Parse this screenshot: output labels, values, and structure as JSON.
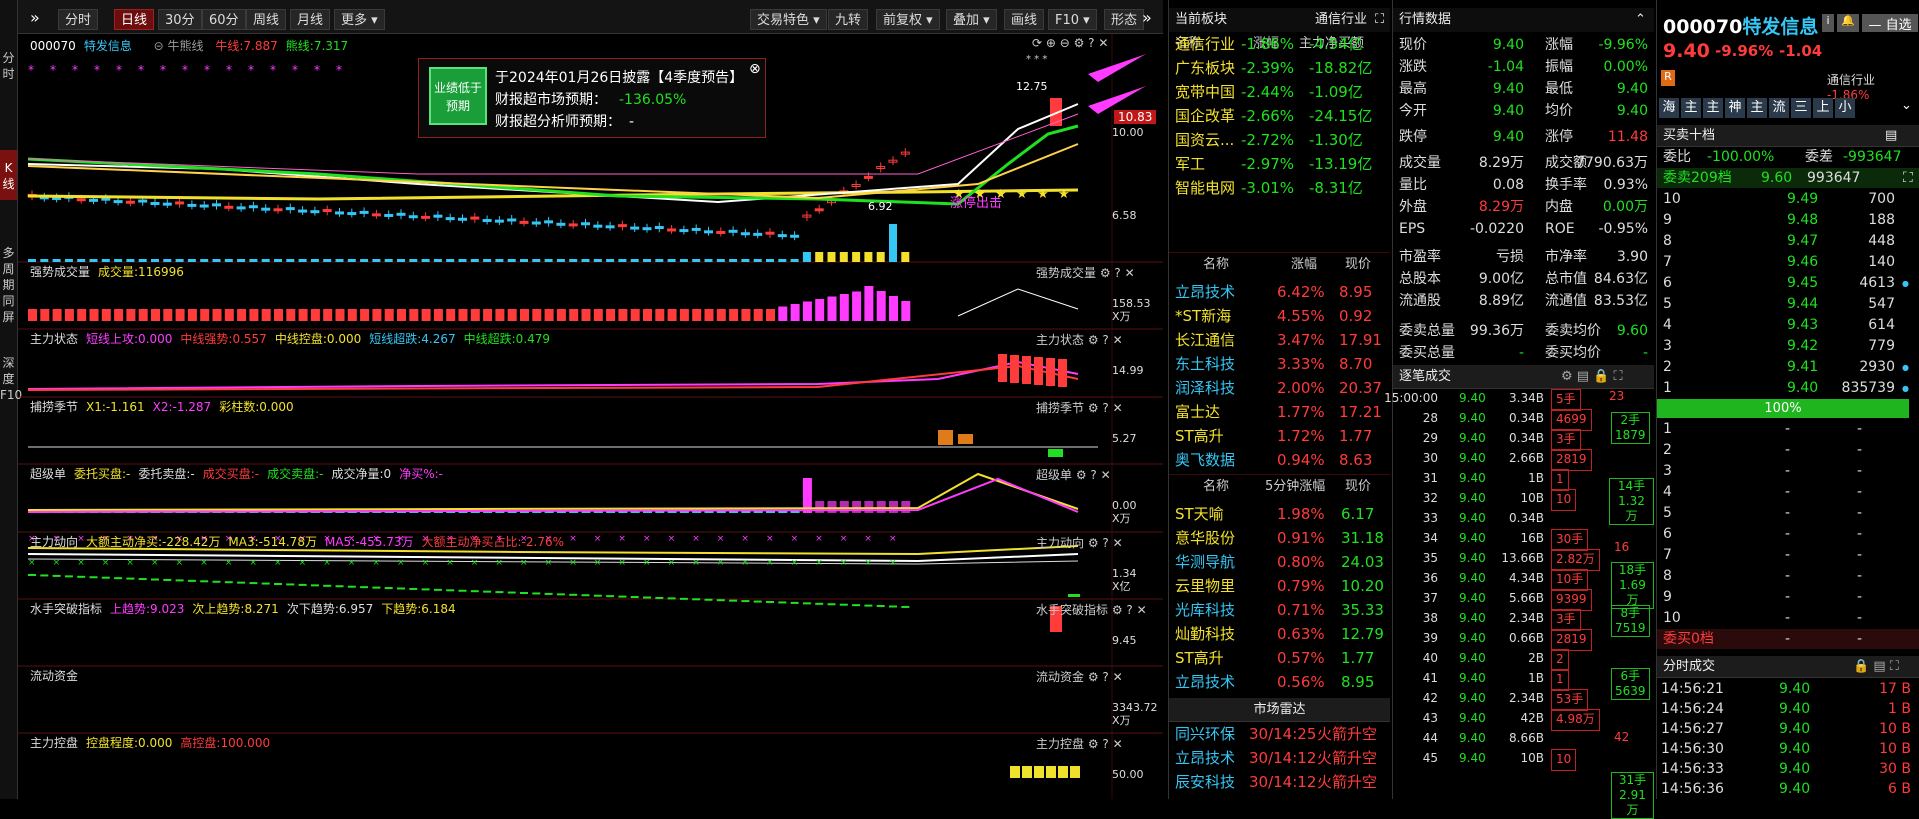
{
  "left_tabs": [
    "分时",
    "K线",
    "多周期同屏",
    "深度F10"
  ],
  "toolbar": {
    "left": [
      "分时",
      "日线",
      "30分",
      "60分",
      "周线",
      "月线",
      "更多"
    ],
    "right": [
      "交易特色",
      "九转",
      "前复权",
      "叠加",
      "画线",
      "F10",
      "形态"
    ]
  },
  "chart": {
    "code": "000070",
    "name": "特发信息",
    "line": "牛熊线",
    "bull": "牛线:7.887",
    "bear": "熊线:7.317",
    "price_high": "12.75",
    "price_low": "6.92",
    "price_tag": "10.83",
    "axis": [
      "10.00",
      "6.58"
    ],
    "annotation": "涨停出击",
    "popup": {
      "icon": "业绩低于预期",
      "line1": "于2024年01月26日披露【4季度预告】",
      "line2_label": "财报超市场预期：",
      "line2_value": "-136.05%",
      "line3_label": "财报超分析师预期：",
      "line3_value": "-"
    }
  },
  "indicators": [
    {
      "title": "强势成交量",
      "items": [
        "成交量:116996"
      ],
      "axis": [
        "158.53",
        "X万"
      ]
    },
    {
      "title": "主力状态",
      "items": [
        "短线上攻:0.000",
        "中线强势:0.557",
        "中线控盘:0.000",
        "短线超跌:4.267",
        "中线超跌:0.479"
      ],
      "axis": [
        "14.99"
      ]
    },
    {
      "title": "捕捞季节",
      "items": [
        "X1:-1.161",
        "X2:-1.287",
        "彩柱数:0.000"
      ],
      "axis": [
        "5.27"
      ]
    },
    {
      "title": "超级单",
      "items": [
        "委托买盘:-",
        "委托卖盘:-",
        "成交买盘:-",
        "成交卖盘:-",
        "成交净量:0",
        "净买%:-"
      ],
      "axis": [
        "0.00",
        "X万"
      ]
    },
    {
      "title": "主力动向",
      "items": [
        "大额主动净买:-228.42万",
        "MA3:-514.78万",
        "MA5:-455.73万",
        "大额主动净买占比:-2.76%"
      ],
      "axis": [
        "1.34",
        "X亿"
      ]
    },
    {
      "title": "水手突破指标",
      "items": [
        "上趋势:9.023",
        "次上趋势:8.271",
        "次下趋势:6.957",
        "下趋势:6.184"
      ],
      "axis": [
        "9.45"
      ]
    },
    {
      "title": "流动资金",
      "items": [],
      "axis": [
        "3343.72",
        "X万"
      ]
    },
    {
      "title": "主力控盘",
      "items": [
        "控盘程度:0.000",
        "高控盘:100.000"
      ],
      "axis": [
        "50.00"
      ]
    }
  ],
  "sector": {
    "title": "当前板块",
    "industry": "通信行业",
    "cols": [
      "名称",
      "涨幅",
      "主力净买额"
    ],
    "rows": [
      [
        "通信行业",
        "-1.86%",
        "-4.54亿"
      ],
      [
        "广东板块",
        "-2.39%",
        "-18.82亿"
      ],
      [
        "宽带中国",
        "-2.44%",
        "-1.09亿"
      ],
      [
        "国企改革",
        "-2.66%",
        "-24.15亿"
      ],
      [
        "国资云...",
        "-2.72%",
        "-1.30亿"
      ],
      [
        "军工",
        "-2.97%",
        "-13.19亿"
      ],
      [
        "智能电网",
        "-3.01%",
        "-8.31亿"
      ]
    ],
    "stock_cols": [
      "名称",
      "涨幅",
      "现价"
    ],
    "stocks": [
      [
        "立昂技术",
        "6.42%",
        "8.95"
      ],
      [
        "*ST新海",
        "4.55%",
        "0.92"
      ],
      [
        "长江通信",
        "3.47%",
        "17.91"
      ],
      [
        "东土科技",
        "3.33%",
        "8.70"
      ],
      [
        "润泽科技",
        "2.00%",
        "20.37"
      ],
      [
        "富士达",
        "1.77%",
        "17.21"
      ],
      [
        "ST高升",
        "1.72%",
        "1.77"
      ],
      [
        "奥飞数据",
        "0.94%",
        "8.63"
      ]
    ],
    "speed_cols": [
      "名称",
      "5分钟涨幅",
      "现价"
    ],
    "speed": [
      [
        "ST天喻",
        "1.98%",
        "6.17"
      ],
      [
        "意华股份",
        "0.91%",
        "31.18"
      ],
      [
        "华测导航",
        "0.80%",
        "24.03"
      ],
      [
        "云里物里",
        "0.79%",
        "10.20"
      ],
      [
        "光库科技",
        "0.71%",
        "35.33"
      ],
      [
        "灿勤科技",
        "0.63%",
        "12.79"
      ],
      [
        "ST高升",
        "0.57%",
        "1.77"
      ],
      [
        "立昂技术",
        "0.56%",
        "8.95"
      ]
    ],
    "radar_title": "市场雷达",
    "radar": [
      [
        "同兴环保",
        "30/14:25",
        "火箭升空"
      ],
      [
        "立昂技术",
        "30/14:12",
        "火箭升空"
      ],
      [
        "辰安科技",
        "30/14:12",
        "火箭升空"
      ]
    ]
  },
  "quote": {
    "title": "行情数据",
    "rows": [
      [
        "现价",
        "9.40",
        "涨幅",
        "-9.96%"
      ],
      [
        "涨跌",
        "-1.04",
        "振幅",
        "0.00%"
      ],
      [
        "最高",
        "9.40",
        "最低",
        "9.40"
      ],
      [
        "今开",
        "9.40",
        "均价",
        "9.40"
      ],
      [
        "跌停",
        "9.40",
        "涨停",
        "11.48"
      ],
      [
        "成交量",
        "8.29万",
        "成交额",
        "7790.63万"
      ],
      [
        "量比",
        "0.08",
        "换手率",
        "0.93%"
      ],
      [
        "外盘",
        "8.29万",
        "内盘",
        "0.00万"
      ],
      [
        "EPS",
        "-0.0220",
        "ROE",
        "-0.95%"
      ],
      [
        "市盈率",
        "亏损",
        "市净率",
        "3.90"
      ],
      [
        "总股本",
        "9.00亿",
        "总市值",
        "84.63亿"
      ],
      [
        "流通股",
        "8.89亿",
        "流通值",
        "83.53亿"
      ],
      [
        "委卖总量",
        "99.36万",
        "委卖均价",
        "9.60"
      ],
      [
        "委买总量",
        "-",
        "委买均价",
        "-"
      ]
    ],
    "ticks_title": "逐笔成交",
    "ticks": [
      [
        "15:00:00",
        "9.40",
        "3.34B",
        "5手",
        "23"
      ],
      [
        "28",
        "9.40",
        "0.34B",
        "4699",
        ""
      ],
      [
        "29",
        "9.40",
        "0.34B",
        "3手",
        ""
      ],
      [
        "30",
        "9.40",
        "2.66B",
        "2819",
        ""
      ],
      [
        "31",
        "9.40",
        "1B",
        "1",
        ""
      ],
      [
        "32",
        "9.40",
        "10B",
        "10",
        ""
      ],
      [
        "33",
        "9.40",
        "0.34B",
        "",
        ""
      ],
      [
        "34",
        "9.40",
        "16B",
        "30手",
        ""
      ],
      [
        "35",
        "9.40",
        "13.66B",
        "2.82万",
        ""
      ],
      [
        "36",
        "9.40",
        "4.34B",
        "10手",
        ""
      ],
      [
        "37",
        "9.40",
        "5.66B",
        "9399",
        ""
      ],
      [
        "38",
        "9.40",
        "2.34B",
        "3手",
        ""
      ],
      [
        "39",
        "9.40",
        "0.66B",
        "2819",
        ""
      ],
      [
        "40",
        "9.40",
        "2B",
        "2",
        ""
      ],
      [
        "41",
        "9.40",
        "1B",
        "1",
        ""
      ],
      [
        "42",
        "9.40",
        "2.34B",
        "53手",
        ""
      ],
      [
        "43",
        "9.40",
        "42B",
        "4.98万",
        ""
      ],
      [
        "44",
        "9.40",
        "8.66B",
        "",
        ""
      ],
      [
        "45",
        "9.40",
        "10B",
        "10",
        ""
      ]
    ],
    "tick_right": [
      [
        "2手",
        "1879"
      ],
      [
        "16"
      ],
      [
        "18手",
        "1.69万"
      ],
      [
        "8手",
        "7519"
      ],
      [
        "6手",
        "5639"
      ],
      [
        "42"
      ],
      [
        "31手",
        "2.91万"
      ]
    ],
    "tick_right_top": [
      "14手",
      "1.32万"
    ]
  },
  "order": {
    "code": "000070",
    "name": "特发信息",
    "self": "自选",
    "price": "9.40",
    "pct": "-9.96%",
    "chg": "-1.04",
    "industry": "通信行业",
    "ind_pct": "-1.86%",
    "tags": [
      "海",
      "主",
      "主",
      "神",
      "主",
      "流",
      "三",
      "上",
      "小"
    ],
    "book_title": "买卖十档",
    "weibi_label": "委比",
    "weibi": "-100.00%",
    "weicha_label": "委差",
    "weicha": "-993647",
    "sell_label": "委卖209档",
    "sell_price": "9.60",
    "sell_vol": "993647",
    "asks": [
      [
        "10",
        "9.49",
        "700"
      ],
      [
        "9",
        "9.48",
        "188"
      ],
      [
        "8",
        "9.47",
        "448"
      ],
      [
        "7",
        "9.46",
        "140"
      ],
      [
        "6",
        "9.45",
        "4613"
      ],
      [
        "5",
        "9.44",
        "547"
      ],
      [
        "4",
        "9.43",
        "614"
      ],
      [
        "3",
        "9.42",
        "779"
      ],
      [
        "2",
        "9.41",
        "2930"
      ],
      [
        "1",
        "9.40",
        "835739"
      ]
    ],
    "ratio": "100%",
    "bids": [
      "1",
      "2",
      "3",
      "4",
      "5",
      "6",
      "7",
      "8",
      "9",
      "10"
    ],
    "buy_label": "委买0档",
    "ticks_title": "分时成交",
    "ticks": [
      [
        "14:56:21",
        "9.40",
        "17 B"
      ],
      [
        "14:56:24",
        "9.40",
        "1 B"
      ],
      [
        "14:56:27",
        "9.40",
        "10 B"
      ],
      [
        "14:56:30",
        "9.40",
        "10 B"
      ],
      [
        "14:56:33",
        "9.40",
        "30 B"
      ],
      [
        "14:56:36",
        "9.40",
        "6 B"
      ]
    ]
  },
  "colors": {
    "up": "#ff3b3b",
    "down": "#1fe11f",
    "yellow": "#f2e12c",
    "cyan": "#35c6f4",
    "magenta": "#ff3bff"
  }
}
